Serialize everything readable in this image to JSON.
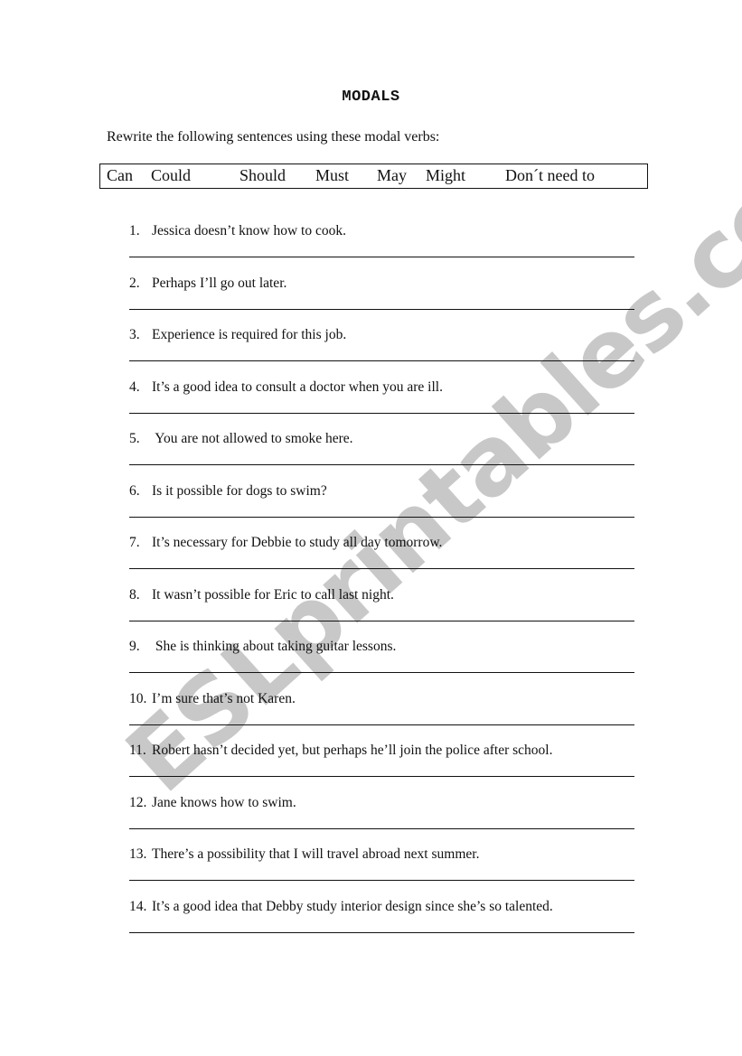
{
  "title": "MODALS",
  "instructions": "Rewrite the following sentences using these modal verbs:",
  "modal_verbs": [
    "Can",
    "Could",
    "Should",
    "Must",
    "May",
    "Might",
    "Don´t need to"
  ],
  "items": [
    {
      "number": "1.",
      "text": "Jessica doesn’t know how to cook."
    },
    {
      "number": "2.",
      "text": "Perhaps I’ll go out later."
    },
    {
      "number": "3.",
      "text": "Experience is required for this job."
    },
    {
      "number": "4.",
      "text": "It’s a good idea to consult a doctor when you are ill."
    },
    {
      "number": "5.",
      "text": " You are not allowed to smoke here."
    },
    {
      "number": "6.",
      "text": "Is it possible for dogs to swim?"
    },
    {
      "number": "7.",
      "text": "It’s necessary for Debbie to study all day tomorrow."
    },
    {
      "number": "8.",
      "text": "It wasn’t possible for Eric to call last night."
    },
    {
      "number": "9.",
      "text": " She is thinking about taking guitar lessons."
    },
    {
      "number": "10.",
      "text": "I’m sure that’s not Karen."
    },
    {
      "number": "11.",
      "text": "Robert hasn’t decided yet, but perhaps he’ll join the police after school."
    },
    {
      "number": "12.",
      "text": "Jane knows how to swim."
    },
    {
      "number": "13.",
      "text": "There’s a possibility that I will travel abroad next summer."
    },
    {
      "number": "14.",
      "text": "It’s a good idea that Debby study interior design since she’s so talented."
    }
  ],
  "watermark": "ESLprintables.com"
}
